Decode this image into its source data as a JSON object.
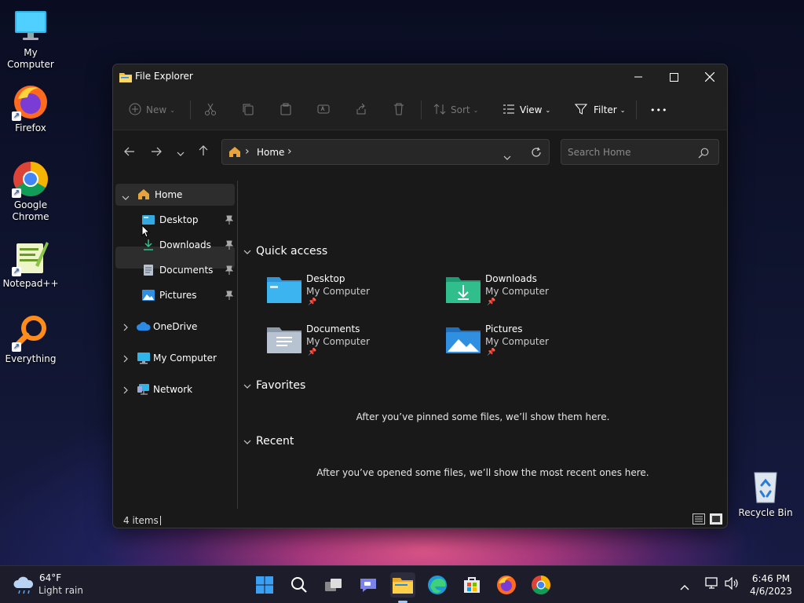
{
  "desktop": {
    "icons": [
      {
        "label": "My Computer",
        "icon": "monitor-icon"
      },
      {
        "label": "Firefox",
        "icon": "firefox-icon"
      },
      {
        "label": "Google Chrome",
        "icon": "chrome-icon"
      },
      {
        "label": "Notepad++",
        "icon": "notepadpp-icon"
      },
      {
        "label": "Everything",
        "icon": "everything-icon"
      },
      {
        "label": "Recycle Bin",
        "icon": "recycle-bin-icon"
      }
    ]
  },
  "window": {
    "title": "File Explorer",
    "toolbar": {
      "new_label": "New",
      "sort_label": "Sort",
      "view_label": "View",
      "filter_label": "Filter",
      "more_label": "•••"
    },
    "address": {
      "segment": "Home",
      "separator": "›"
    },
    "search": {
      "placeholder": "Search Home"
    },
    "sidebar": {
      "home": "Home",
      "pinned": [
        {
          "label": "Desktop"
        },
        {
          "label": "Downloads"
        },
        {
          "label": "Documents"
        },
        {
          "label": "Pictures"
        }
      ],
      "onedrive": "OneDrive",
      "mycomputer": "My Computer",
      "network": "Network"
    },
    "content": {
      "quick_access_title": "Quick access",
      "quick_access": [
        {
          "name": "Desktop",
          "location": "My Computer"
        },
        {
          "name": "Downloads",
          "location": "My Computer"
        },
        {
          "name": "Documents",
          "location": "My Computer"
        },
        {
          "name": "Pictures",
          "location": "My Computer"
        }
      ],
      "favorites_title": "Favorites",
      "favorites_empty": "After you’ve pinned some files, we’ll show them here.",
      "recent_title": "Recent",
      "recent_empty": "After you’ve opened some files, we’ll show the most recent ones here."
    },
    "status": {
      "items": "4 items"
    }
  },
  "taskbar": {
    "weather": {
      "temp": "64°F",
      "desc": "Light rain"
    },
    "clock": {
      "time": "6:46 PM",
      "date": "4/6/2023"
    }
  },
  "colors": {
    "accent": "#0078d4",
    "folder": "#f3c13a",
    "window_bg": "#191919"
  }
}
